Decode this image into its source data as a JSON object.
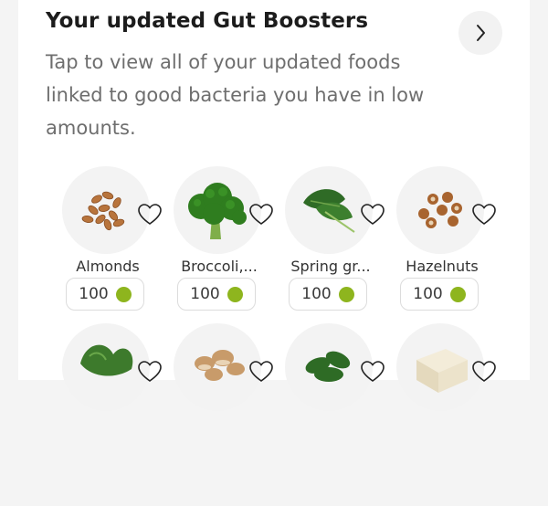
{
  "section": {
    "title": "Your updated Gut Boosters",
    "subtitle": "Tap to view all of your updated foods linked to good bacteria you have in low amounts."
  },
  "foods": [
    {
      "name": "Almonds",
      "score": "100",
      "icon": "almonds-image"
    },
    {
      "name": "Broccoli,...",
      "score": "100",
      "icon": "broccoli-image"
    },
    {
      "name": "Spring gr...",
      "score": "100",
      "icon": "spring-greens-image"
    },
    {
      "name": "Hazelnuts",
      "score": "100",
      "icon": "hazelnuts-image"
    }
  ],
  "second_row_icons": [
    "kale-image",
    "mushrooms-image",
    "spinach-image",
    "tofu-image"
  ],
  "colors": {
    "score_dot": "#8eb51e",
    "card_bg": "#ffffff",
    "page_bg": "#f4f4f4"
  },
  "icons": {
    "next": "chevron-right-icon",
    "favorite": "heart-outline-icon"
  }
}
